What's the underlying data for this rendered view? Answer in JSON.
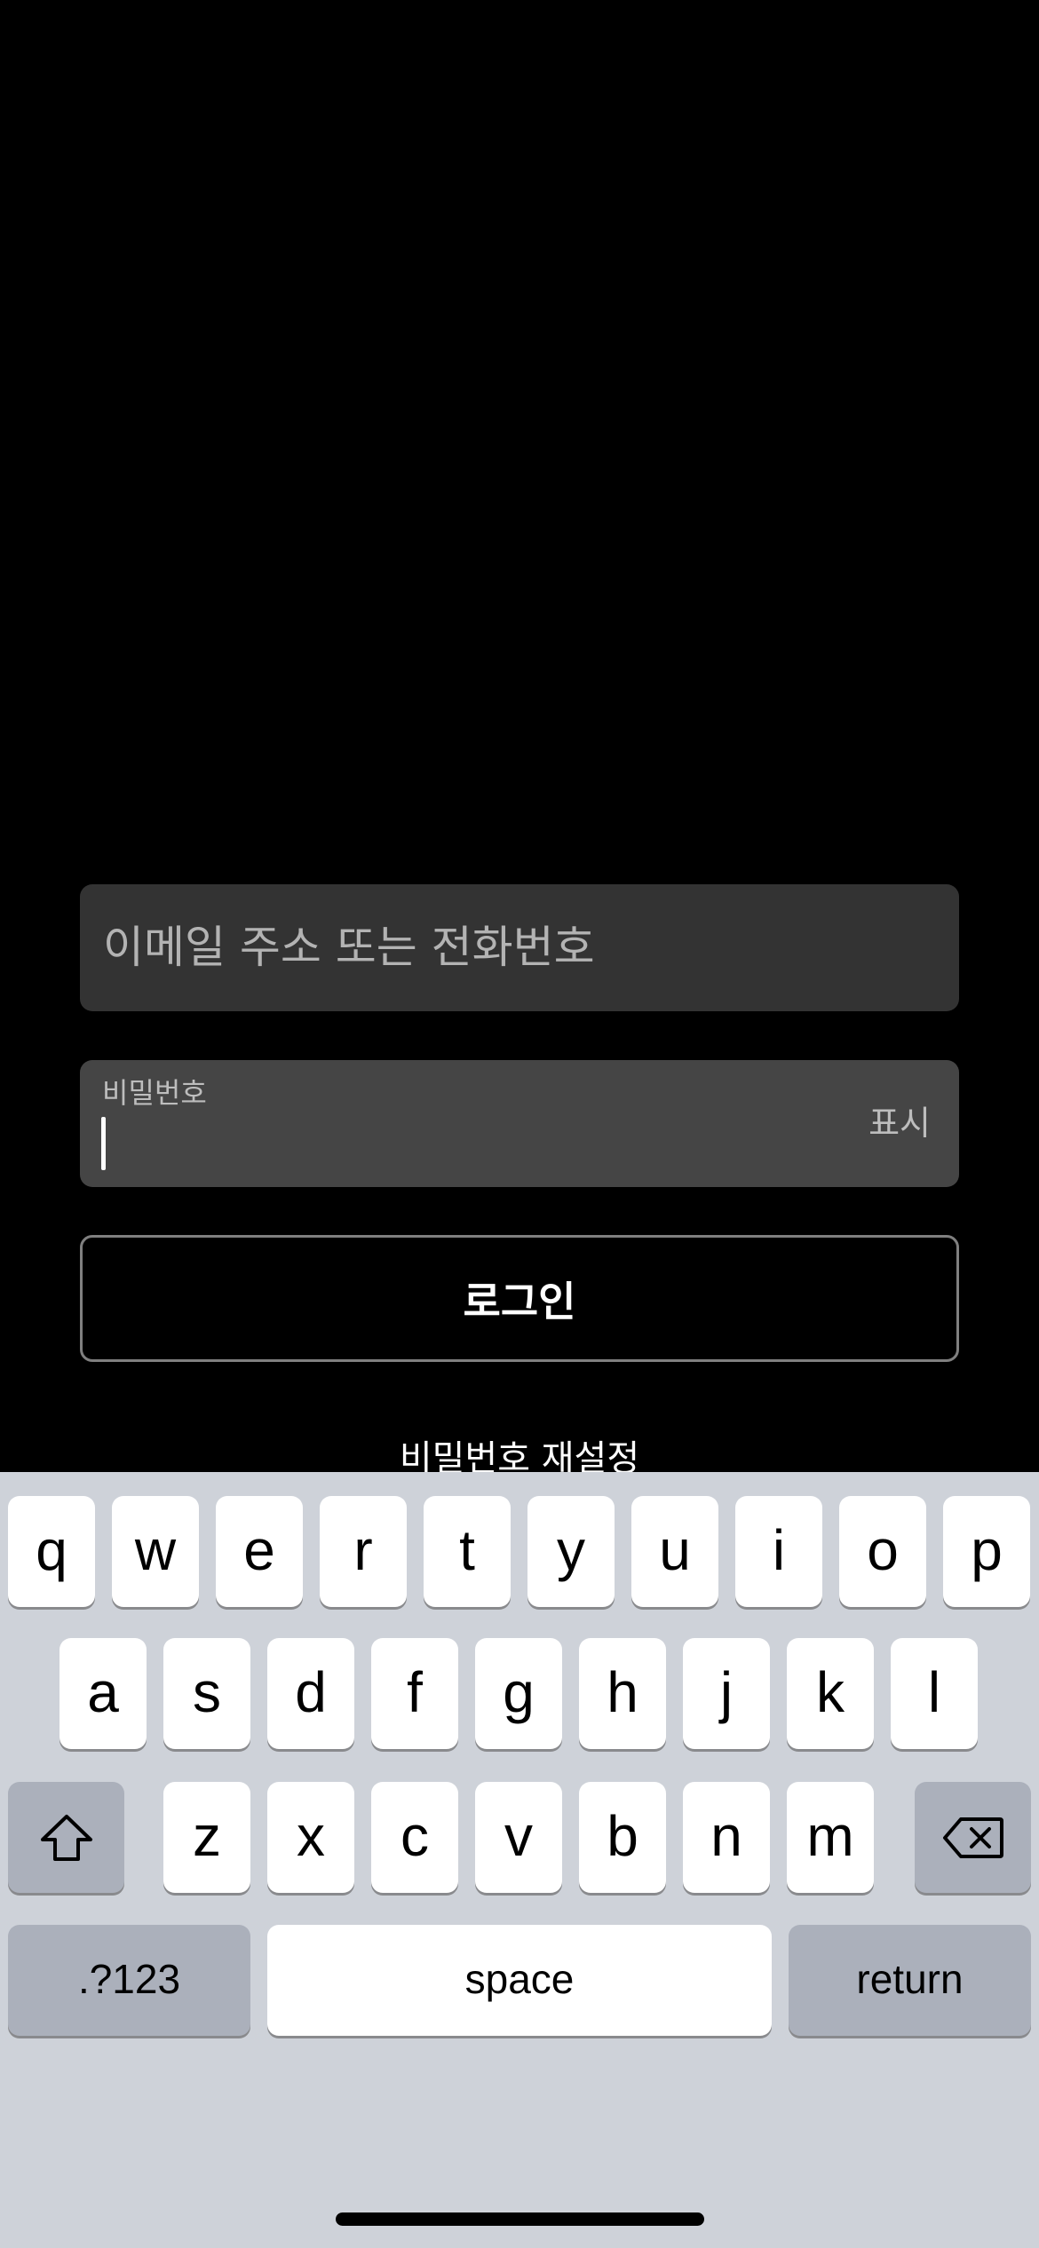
{
  "login": {
    "email_placeholder": "이메일 주소 또는 전화번호",
    "password_label": "비밀번호",
    "password_toggle": "표시",
    "login_button": "로그인",
    "reset_password": "비밀번호 재설정"
  },
  "keyboard": {
    "row1": [
      "q",
      "w",
      "e",
      "r",
      "t",
      "y",
      "u",
      "i",
      "o",
      "p"
    ],
    "row2": [
      "a",
      "s",
      "d",
      "f",
      "g",
      "h",
      "j",
      "k",
      "l"
    ],
    "row3": [
      "z",
      "x",
      "c",
      "v",
      "b",
      "n",
      "m"
    ],
    "numbers_key": ".?123",
    "space_key": "space",
    "return_key": "return",
    "shift_icon": "shift-arrow-icon",
    "delete_icon": "backspace-icon"
  },
  "colors": {
    "background": "#000000",
    "email_field_bg": "#333333",
    "password_field_bg": "#454545",
    "keyboard_bg": "#ced2d9",
    "key_bg": "#ffffff",
    "function_key_bg": "#abb0bb"
  }
}
